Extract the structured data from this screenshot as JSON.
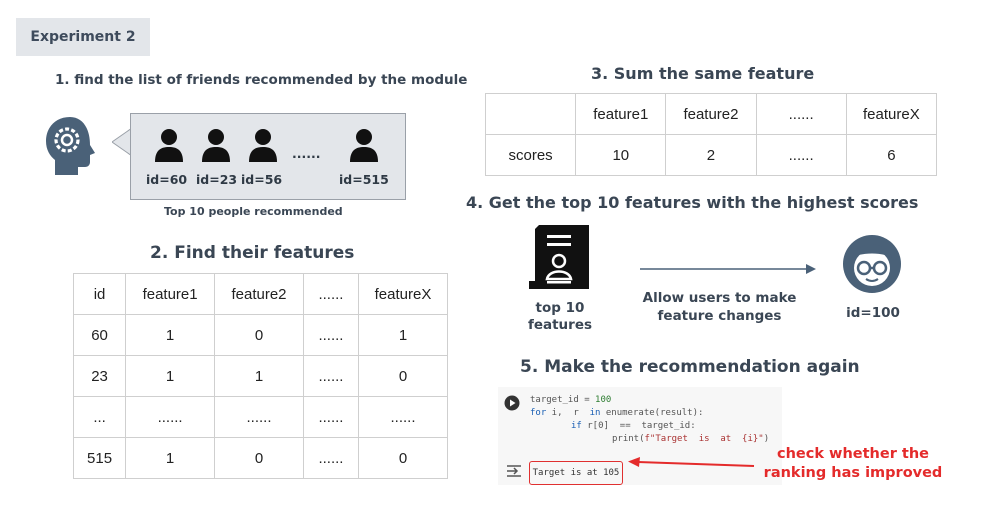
{
  "badge": "Experiment 2",
  "step1": {
    "title": "1. find the list of friends recommended by the module",
    "ids": [
      "id=60",
      "id=23",
      "id=56",
      "id=515"
    ],
    "dots": "......",
    "caption": "Top 10 people recommended"
  },
  "step2": {
    "title": "2. Find their features",
    "table": [
      [
        "id",
        "feature1",
        "feature2",
        "......",
        "featureX"
      ],
      [
        "60",
        "1",
        "0",
        "......",
        "1"
      ],
      [
        "23",
        "1",
        "1",
        "......",
        "0"
      ],
      [
        "...",
        "......",
        "......",
        "......",
        "......"
      ],
      [
        "515",
        "1",
        "0",
        "......",
        "0"
      ]
    ]
  },
  "step3": {
    "title": "3. Sum the same feature",
    "table": [
      [
        "",
        "feature1",
        "feature2",
        "......",
        "featureX"
      ],
      [
        "scores",
        "10",
        "2",
        "......",
        "6"
      ]
    ]
  },
  "step4": {
    "title": "4. Get the top 10 features with the highest scores",
    "left_label": "top 10\nfeatures",
    "arrow_label": "Allow users to make\nfeature changes",
    "right_label": "id=100"
  },
  "step5": {
    "title": "5. Make the recommendation again",
    "code": {
      "line1_a": "target_id",
      "line1_b": " = ",
      "line1_c": "100",
      "line2_a": "for",
      "line2_b": " i,  r  ",
      "line2_c": "in",
      "line2_d": " enumerate(result):",
      "line3_a": "if",
      "line3_b": " r[0]  ==  target_id:",
      "line4_a": "print(",
      "line4_b": "f\"Target  is  at  {i}\"",
      "line4_c": ")"
    },
    "output": "Target is at 105",
    "note": "check whether the\nranking has improved"
  },
  "colors": {
    "heading": "#3a4654",
    "icon": "#4a6178",
    "accent_red": "#e42b2b",
    "badge_bg": "#e3e6ea"
  }
}
